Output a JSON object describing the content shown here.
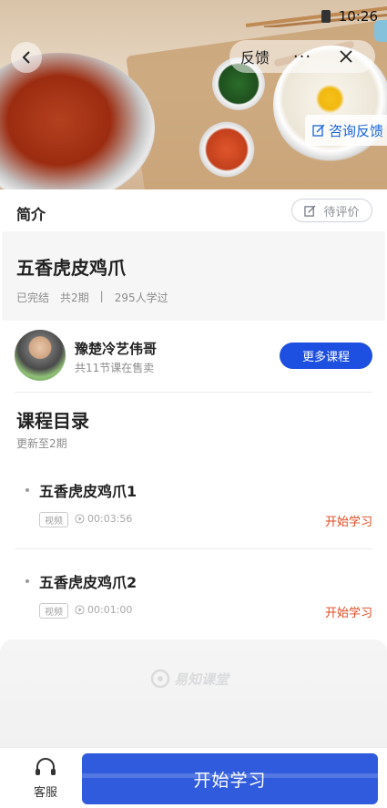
{
  "status_bar": {
    "time": "10:26"
  },
  "header": {
    "feedback_label": "反馈",
    "more_label": "···",
    "consult_label": "咨询反馈"
  },
  "intro": {
    "label": "简介",
    "rating_label": "待评价"
  },
  "course": {
    "title": "五香虎皮鸡爪",
    "status": "已完结",
    "episodes": "共2期",
    "separator": "|",
    "learners": "295人学过"
  },
  "teacher": {
    "name": "豫楚冷艺伟哥",
    "subtitle": "共11节课在售卖",
    "more_label": "更多课程"
  },
  "catalog": {
    "title": "课程目录",
    "subtitle": "更新至2期",
    "lessons": [
      {
        "name": "五香虎皮鸡爪1",
        "type": "视频",
        "duration": "00:03:56",
        "action": "开始学习"
      },
      {
        "name": "五香虎皮鸡爪2",
        "type": "视频",
        "duration": "00:01:00",
        "action": "开始学习"
      }
    ]
  },
  "brand": {
    "watermark": "易知课堂"
  },
  "bottom": {
    "service_label": "客服",
    "start_label": "开始学习"
  },
  "colors": {
    "primary": "#2f5bdc",
    "accent_action": "#e04a1f",
    "consult_text": "#1763d8"
  }
}
